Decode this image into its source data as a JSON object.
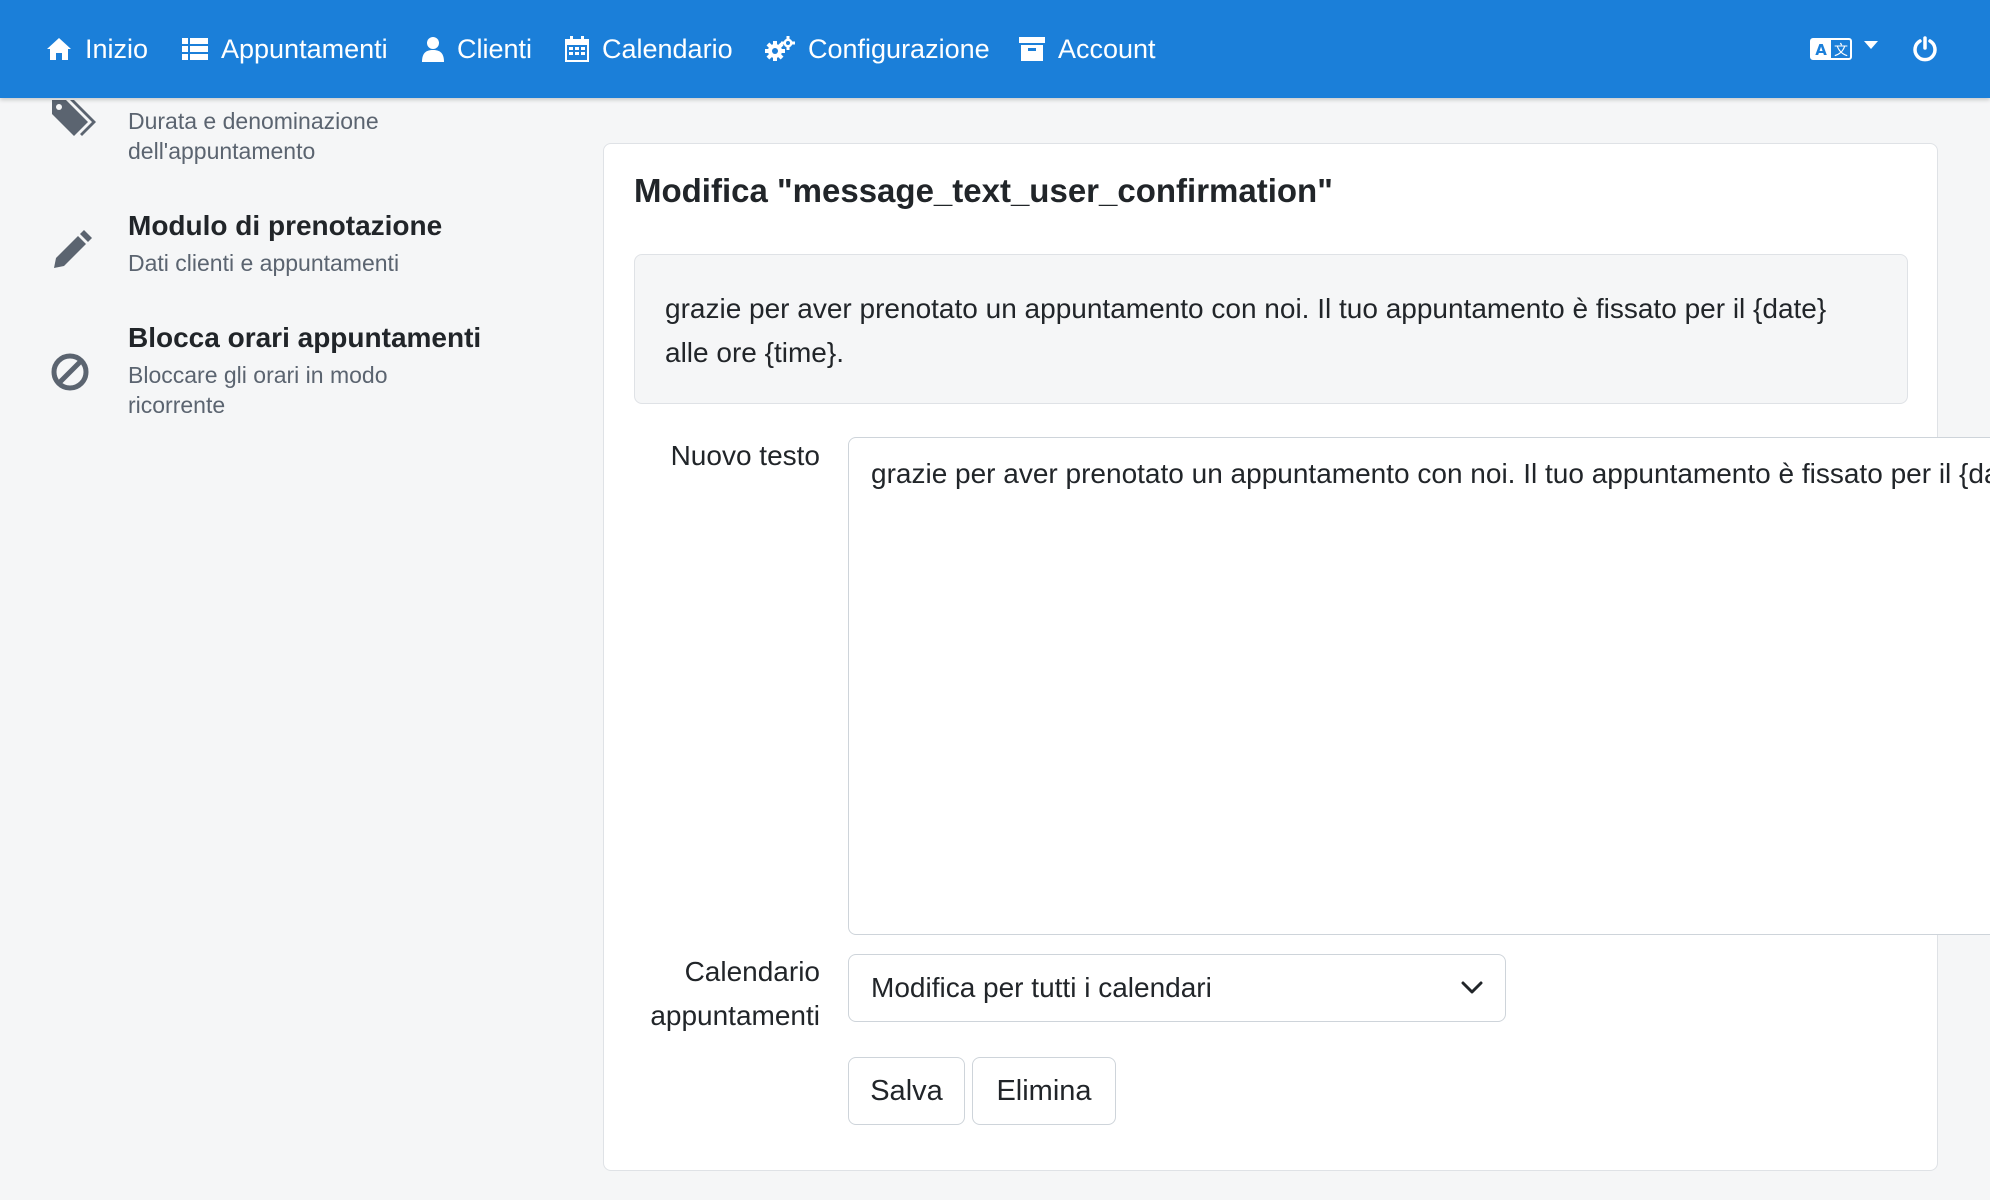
{
  "navbar": {
    "items": [
      {
        "label": "Inizio",
        "icon": "home-icon"
      },
      {
        "label": "Appuntamenti",
        "icon": "list-icon"
      },
      {
        "label": "Clienti",
        "icon": "user-icon"
      },
      {
        "label": "Calendario",
        "icon": "calendar-icon"
      },
      {
        "label": "Configurazione",
        "icon": "cogs-icon"
      },
      {
        "label": "Account",
        "icon": "archive-icon"
      }
    ],
    "language_icon": "language-icon",
    "power_icon": "power-icon",
    "background_color": "#1b7fd9"
  },
  "sidebar": {
    "items": [
      {
        "title": "",
        "description": "Durata e denominazione dell'appuntamento",
        "icon": "tags-icon"
      },
      {
        "title": "Modulo di prenotazione",
        "description": "Dati clienti e appuntamenti",
        "icon": "pencil-icon"
      },
      {
        "title": "Blocca orari appuntamenti",
        "description": "Bloccare gli orari in modo ricorrente",
        "icon": "ban-icon"
      }
    ]
  },
  "editor": {
    "title": "Modifica \"message_text_user_confirmation\"",
    "current_text": "grazie per aver prenotato un appuntamento con noi. Il tuo appuntamento è fissato per il {date} alle ore {time}.",
    "new_text_label": "Nuovo testo",
    "new_text_value": "grazie per aver prenotato un appuntamento con noi. Il tuo appuntamento è fissato per il {date} alle ore {time}.",
    "calendar_label_line1": "Calendario",
    "calendar_label_line2": "appuntamenti",
    "calendar_selected": "Modifica per tutti i calendari",
    "save_label": "Salva",
    "delete_label": "Elimina"
  }
}
